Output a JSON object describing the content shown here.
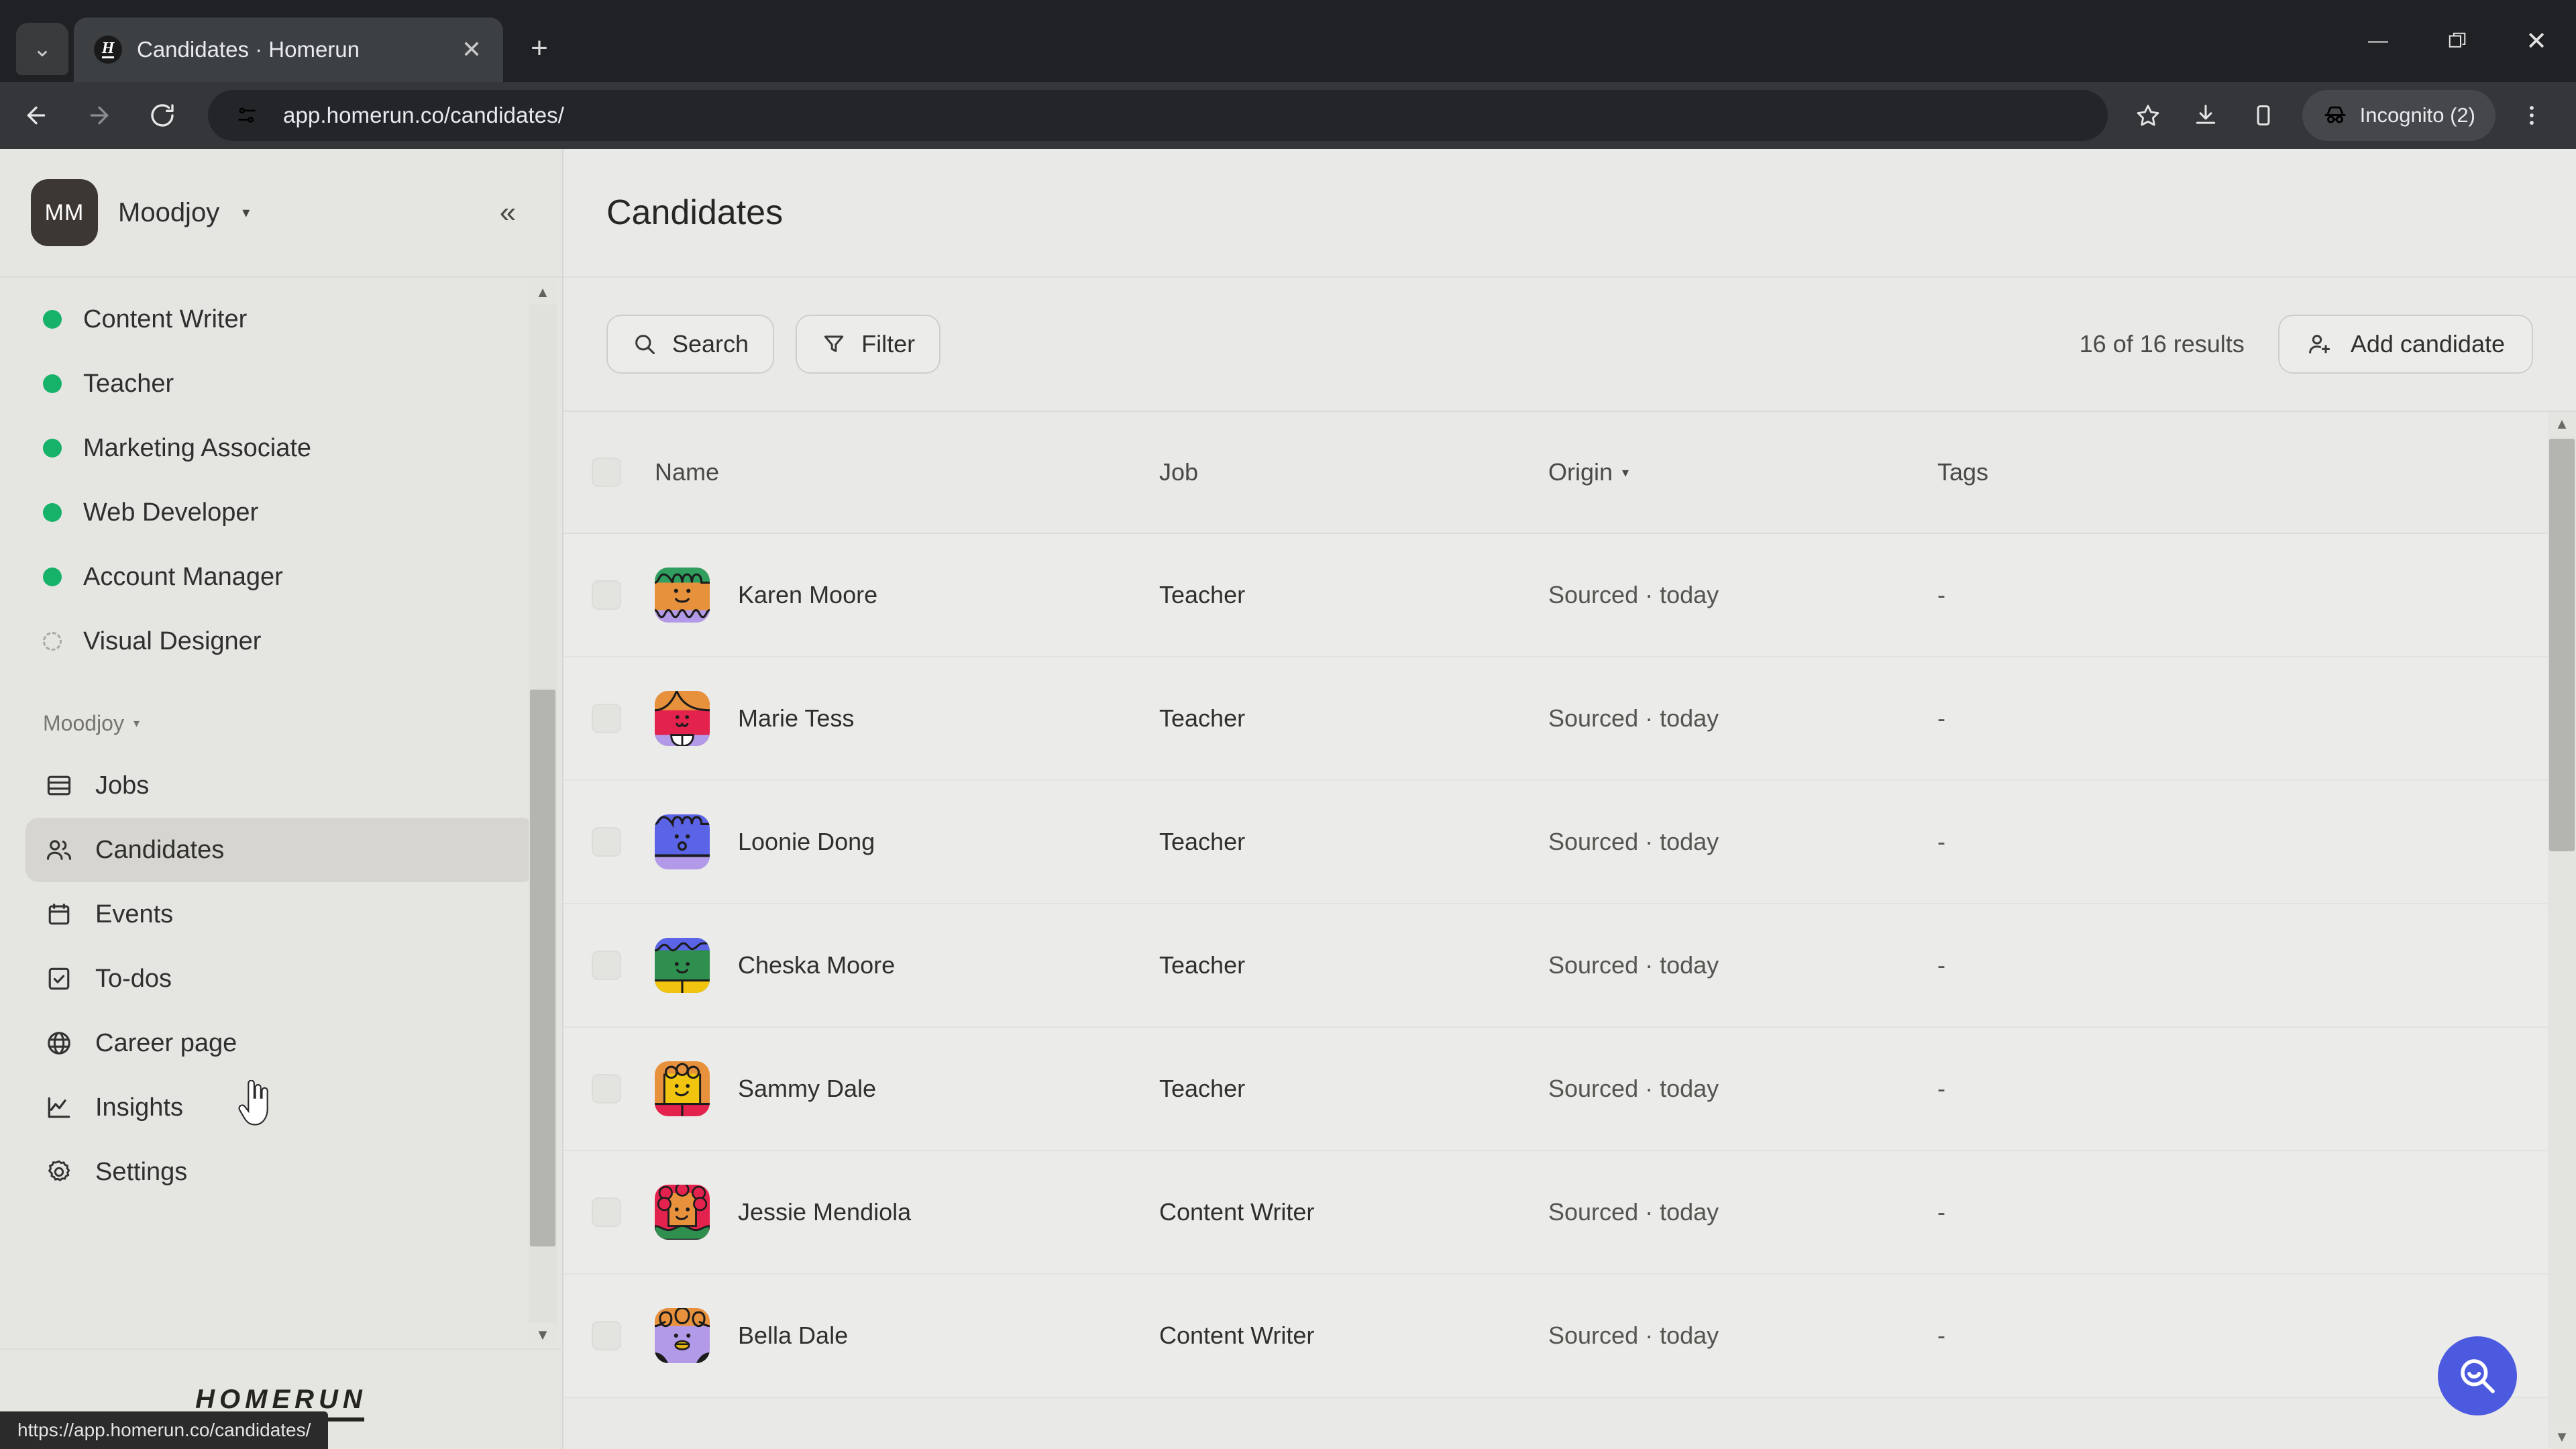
{
  "browser": {
    "tab": {
      "title": "Candidates · Homerun",
      "favicon_letter": "H"
    },
    "tab_search_icon": "chevron-down-icon",
    "new_tab_label": "+",
    "close_tab_label": "✕",
    "window_controls": {
      "minimize": "—",
      "maximize": "maximize-icon",
      "close": "✕"
    },
    "url": "app.homerun.co/candidates/",
    "profile_label": "Incognito (2)",
    "status_url": "https://app.homerun.co/candidates/"
  },
  "sidebar": {
    "workspace": {
      "initials": "MM",
      "name": "Moodjoy",
      "caret": "▾"
    },
    "collapse_label": "«",
    "jobs": [
      {
        "label": "Content Writer",
        "status": "published"
      },
      {
        "label": "Teacher",
        "status": "published"
      },
      {
        "label": "Marketing Associate",
        "status": "published"
      },
      {
        "label": "Web Developer",
        "status": "published"
      },
      {
        "label": "Account Manager",
        "status": "published"
      },
      {
        "label": "Visual Designer",
        "status": "draft"
      }
    ],
    "section": {
      "label": "Moodjoy",
      "caret": "▾"
    },
    "nav": [
      {
        "label": "Jobs",
        "icon": "jobs-icon",
        "active": false
      },
      {
        "label": "Candidates",
        "icon": "candidates-icon",
        "active": true
      },
      {
        "label": "Events",
        "icon": "events-icon",
        "active": false
      },
      {
        "label": "To-dos",
        "icon": "todos-icon",
        "active": false
      },
      {
        "label": "Career page",
        "icon": "globe-icon",
        "active": false
      },
      {
        "label": "Insights",
        "icon": "insights-icon",
        "active": false
      },
      {
        "label": "Settings",
        "icon": "gear-icon",
        "active": false
      }
    ],
    "footer_logo": "HOMERUN"
  },
  "main": {
    "title": "Candidates",
    "search_label": "Search",
    "filter_label": "Filter",
    "results_count": "16 of 16 results",
    "add_candidate_label": "Add candidate",
    "columns": [
      "Name",
      "Job",
      "Origin",
      "Tags"
    ],
    "origin_sort_caret": "▾",
    "rows": [
      {
        "name": "Karen Moore",
        "job": "Teacher",
        "origin": "Sourced · today",
        "tags": "-",
        "avatar": "av1"
      },
      {
        "name": "Marie Tess",
        "job": "Teacher",
        "origin": "Sourced · today",
        "tags": "-",
        "avatar": "av2"
      },
      {
        "name": "Loonie Dong",
        "job": "Teacher",
        "origin": "Sourced · today",
        "tags": "-",
        "avatar": "av3"
      },
      {
        "name": "Cheska Moore",
        "job": "Teacher",
        "origin": "Sourced · today",
        "tags": "-",
        "avatar": "av4"
      },
      {
        "name": "Sammy Dale",
        "job": "Teacher",
        "origin": "Sourced · today",
        "tags": "-",
        "avatar": "av5"
      },
      {
        "name": "Jessie Mendiola",
        "job": "Content Writer",
        "origin": "Sourced · today",
        "tags": "-",
        "avatar": "av6"
      },
      {
        "name": "Bella Dale",
        "job": "Content Writer",
        "origin": "Sourced · today",
        "tags": "-",
        "avatar": "av7"
      }
    ],
    "help_icon": "help-search-icon"
  },
  "colors": {
    "accent_blue": "#4c5ae0",
    "status_published": "#17b26a",
    "app_bg": "#e9e9e7",
    "sidebar_bg": "#e5e5e2",
    "chrome_bg": "#35363a"
  }
}
